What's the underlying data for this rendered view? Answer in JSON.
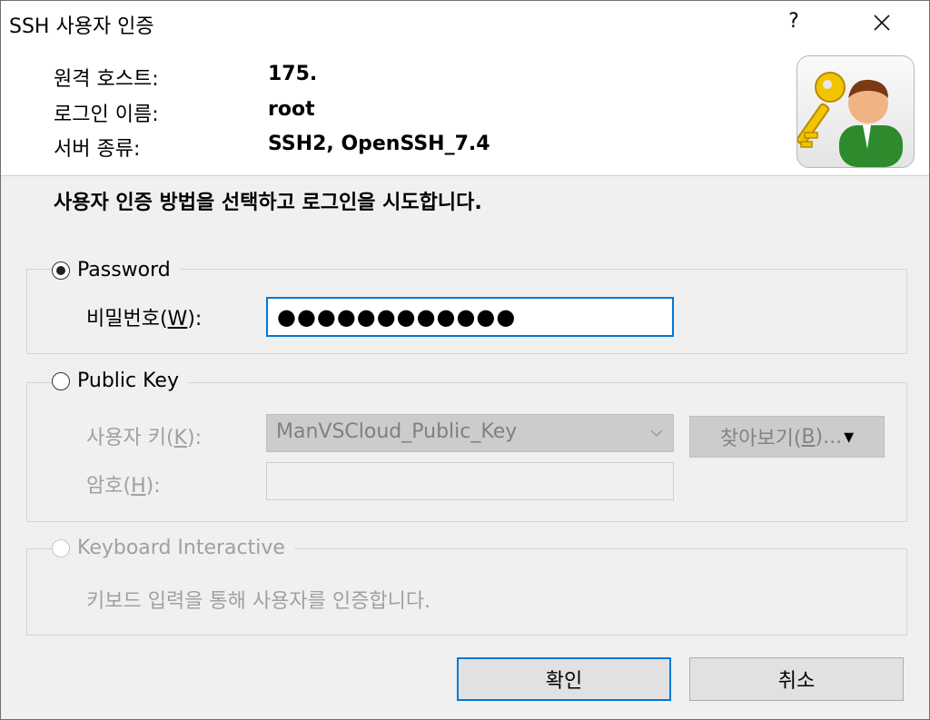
{
  "window": {
    "title": "SSH 사용자 인증",
    "help_label": "?"
  },
  "info": {
    "host_label": "원격 호스트:",
    "host_value": "175.",
    "login_label": "로그인 이름:",
    "login_value": "root",
    "server_label": "서버 종류:",
    "server_value": "SSH2, OpenSSH_7.4"
  },
  "instruction": "사용자 인증 방법을 선택하고 로그인을 시도합니다.",
  "password": {
    "radio_label": "Password",
    "selected": true,
    "field_label_pre": "비밀번호(",
    "field_label_key": "W",
    "field_label_post": "):",
    "masked_value": "●●●●●●●●●●●●"
  },
  "public_key": {
    "radio_label": "Public Key",
    "selected": false,
    "user_key_label_pre": "사용자 키(",
    "user_key_label_key": "K",
    "user_key_label_post": "):",
    "user_key_value": "ManVSCloud_Public_Key",
    "passphrase_label_pre": "암호(",
    "passphrase_label_key": "H",
    "passphrase_label_post": "):",
    "passphrase_value": "",
    "browse_label_pre": "찾아보기(",
    "browse_label_key": "B",
    "browse_label_post": ")...",
    "browse_arrow": "▾"
  },
  "keyboard": {
    "radio_label": "Keyboard Interactive",
    "selected": false,
    "description": "키보드 입력을 통해 사용자를 인증합니다."
  },
  "buttons": {
    "ok": "확인",
    "cancel": "취소"
  },
  "colors": {
    "accent": "#0078d7",
    "dialog_bg": "#f0f0f0",
    "disabled_text": "#a0a0a0"
  },
  "icons": {
    "close": "close-icon",
    "app": "key-user-icon",
    "combo_arrow": "chevron-down-icon"
  }
}
